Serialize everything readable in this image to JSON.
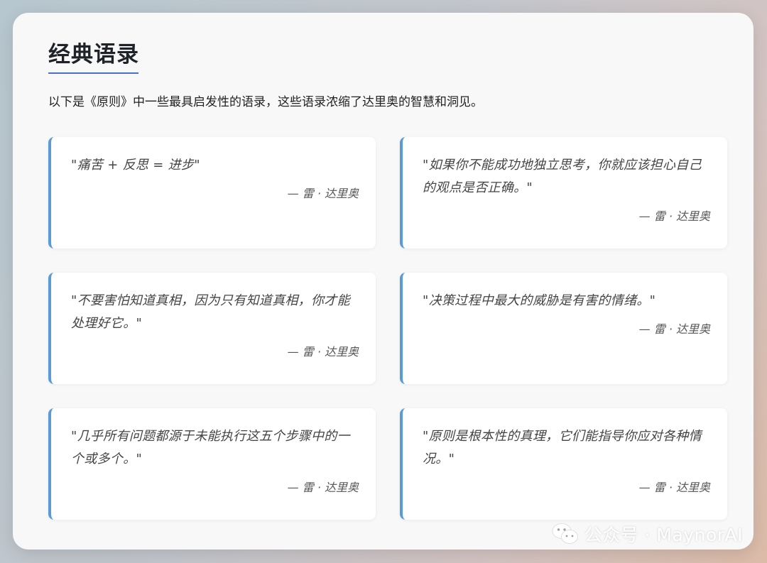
{
  "section": {
    "title": "经典语录",
    "intro": "以下是《原则》中一些最具启发性的语录，这些语录浓缩了达里奥的智慧和洞见。"
  },
  "quotes": [
    {
      "text": "\"痛苦 + 反思 = 进步\"",
      "author": "— 雷 · 达里奥"
    },
    {
      "text": "\"如果你不能成功地独立思考，你就应该担心自己的观点是否正确。\"",
      "author": "— 雷 · 达里奥"
    },
    {
      "text": "\"不要害怕知道真相，因为只有知道真相，你才能处理好它。\"",
      "author": "— 雷 · 达里奥"
    },
    {
      "text": "\"决策过程中最大的威胁是有害的情绪。\"",
      "author": "— 雷 · 达里奥"
    },
    {
      "text": "\"几乎所有问题都源于未能执行这五个步骤中的一个或多个。\"",
      "author": "— 雷 · 达里奥"
    },
    {
      "text": "\"原则是根本性的真理，它们能指导你应对各种情况。\"",
      "author": "— 雷 · 达里奥"
    }
  ],
  "watermark": {
    "icon": "wechat-icon",
    "text": "公众号 · MaynorAI"
  },
  "colors": {
    "accent": "#5b9bd5",
    "title_underline": "#4a6fd0"
  }
}
